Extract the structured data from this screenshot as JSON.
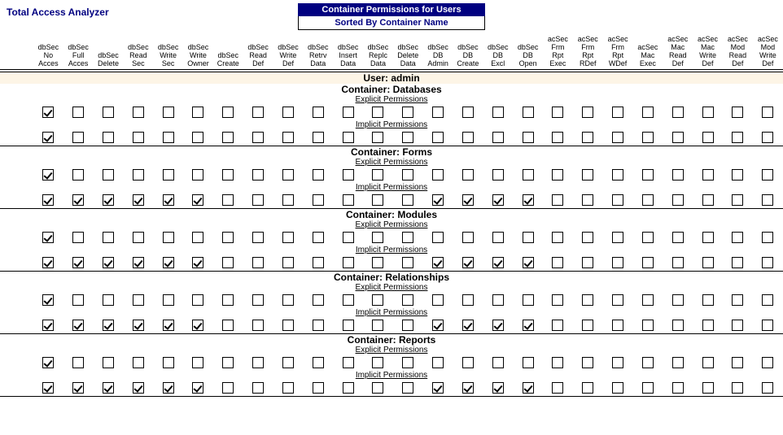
{
  "app_title": "Total Access Analyzer",
  "header": {
    "line1": "Container Permissions for Users",
    "line2": "Sorted By Container Name"
  },
  "columns": [
    "dbSec\nNo\nAcces",
    "dbSec\nFull\nAcces",
    "dbSec\nDelete",
    "dbSec\nRead\nSec",
    "dbSec\nWrite\nSec",
    "dbSec\nWrite\nOwner",
    "dbSec\nCreate",
    "dbSec\nRead\nDef",
    "dbSec\nWrite\nDef",
    "dbSec\nRetrv\nData",
    "dbSec\nInsert\nData",
    "dbSec\nReplc\nData",
    "dbSec\nDelete\nData",
    "dbSec\nDB\nAdmin",
    "dbSec\nDB\nCreate",
    "dbSec\nDB\nExcl",
    "dbSec\nDB\nOpen",
    "acSec\nFrm\nRpt\nExec",
    "acSec\nFrm\nRpt\nRDef",
    "acSec\nFrm\nRpt\nWDef",
    "acSec\nMac\nExec",
    "acSec\nMac\nRead\nDef",
    "acSec\nMac\nWrite\nDef",
    "acSec\nMod\nRead\nDef",
    "acSec\nMod\nWrite\nDef"
  ],
  "user_label": "User: admin",
  "labels": {
    "container_prefix": "Container: ",
    "explicit": "Explicit Permissions",
    "implicit": "Implicit Permissions"
  },
  "containers": [
    {
      "name": "Databases",
      "explicit": [
        1,
        0,
        0,
        0,
        0,
        0,
        0,
        0,
        0,
        0,
        0,
        0,
        0,
        0,
        0,
        0,
        0,
        0,
        0,
        0,
        0,
        0,
        0,
        0,
        0
      ],
      "implicit": [
        1,
        0,
        0,
        0,
        0,
        0,
        0,
        0,
        0,
        0,
        0,
        0,
        0,
        0,
        0,
        0,
        0,
        0,
        0,
        0,
        0,
        0,
        0,
        0,
        0
      ]
    },
    {
      "name": "Forms",
      "explicit": [
        1,
        0,
        0,
        0,
        0,
        0,
        0,
        0,
        0,
        0,
        0,
        0,
        0,
        0,
        0,
        0,
        0,
        0,
        0,
        0,
        0,
        0,
        0,
        0,
        0
      ],
      "implicit": [
        1,
        1,
        1,
        1,
        1,
        1,
        0,
        0,
        0,
        0,
        0,
        0,
        0,
        1,
        1,
        1,
        1,
        0,
        0,
        0,
        0,
        0,
        0,
        0,
        0
      ]
    },
    {
      "name": "Modules",
      "explicit": [
        1,
        0,
        0,
        0,
        0,
        0,
        0,
        0,
        0,
        0,
        0,
        0,
        0,
        0,
        0,
        0,
        0,
        0,
        0,
        0,
        0,
        0,
        0,
        0,
        0
      ],
      "implicit": [
        1,
        1,
        1,
        1,
        1,
        1,
        0,
        0,
        0,
        0,
        0,
        0,
        0,
        1,
        1,
        1,
        1,
        0,
        0,
        0,
        0,
        0,
        0,
        0,
        0
      ]
    },
    {
      "name": "Relationships",
      "explicit": [
        1,
        0,
        0,
        0,
        0,
        0,
        0,
        0,
        0,
        0,
        0,
        0,
        0,
        0,
        0,
        0,
        0,
        0,
        0,
        0,
        0,
        0,
        0,
        0,
        0
      ],
      "implicit": [
        1,
        1,
        1,
        1,
        1,
        1,
        0,
        0,
        0,
        0,
        0,
        0,
        0,
        1,
        1,
        1,
        1,
        0,
        0,
        0,
        0,
        0,
        0,
        0,
        0
      ]
    },
    {
      "name": "Reports",
      "explicit": [
        1,
        0,
        0,
        0,
        0,
        0,
        0,
        0,
        0,
        0,
        0,
        0,
        0,
        0,
        0,
        0,
        0,
        0,
        0,
        0,
        0,
        0,
        0,
        0,
        0
      ],
      "implicit": [
        1,
        1,
        1,
        1,
        1,
        1,
        0,
        0,
        0,
        0,
        0,
        0,
        0,
        1,
        1,
        1,
        1,
        0,
        0,
        0,
        0,
        0,
        0,
        0,
        0
      ]
    }
  ]
}
